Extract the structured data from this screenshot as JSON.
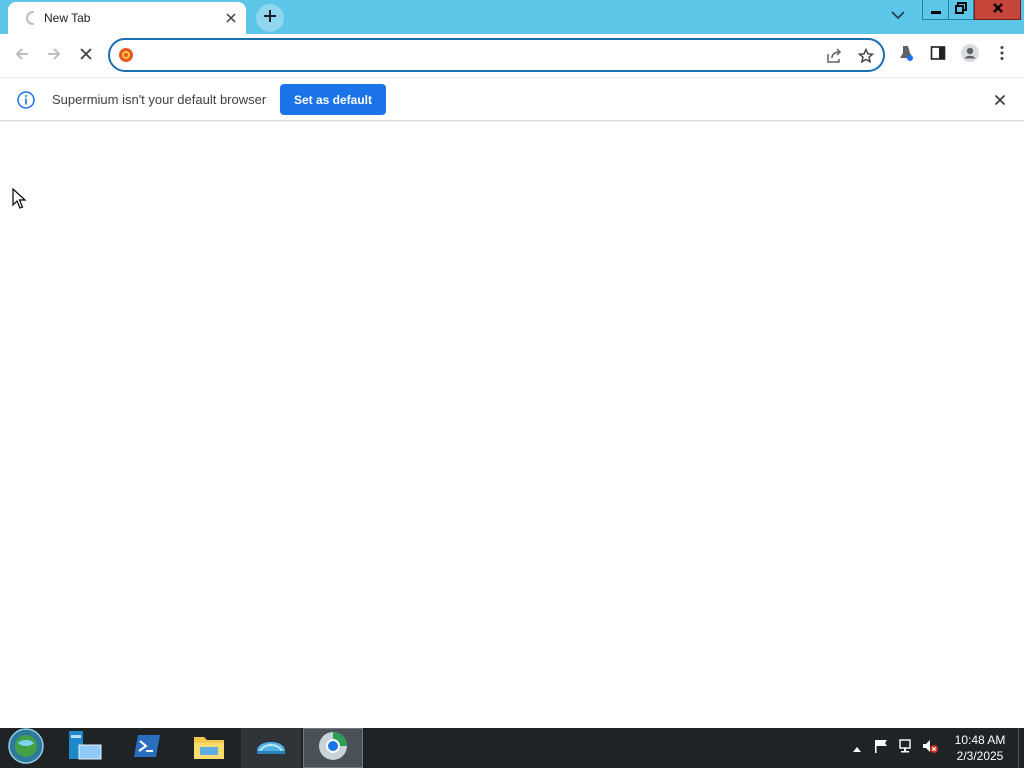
{
  "browser": {
    "tab_title": "New Tab",
    "omnibox_value": "",
    "omnibox_placeholder": ""
  },
  "infobar": {
    "message": "Supermium isn't your default browser",
    "button_label": "Set as default"
  },
  "taskbar": {
    "apps": [
      {
        "name": "server-manager"
      },
      {
        "name": "powershell"
      },
      {
        "name": "file-explorer"
      },
      {
        "name": "network-app"
      },
      {
        "name": "supermium-browser",
        "active": true
      }
    ],
    "time": "10:48 AM",
    "date": "2/3/2025"
  },
  "colors": {
    "tabstrip": "#5cc6e8",
    "accent": "#1a73e8",
    "close_button": "#c7463b",
    "taskbar": "#1f2326"
  },
  "icons": [
    "loading-spinner-icon",
    "close-icon",
    "plus-icon",
    "chevron-down-icon",
    "minimize-icon",
    "restore-icon",
    "back-arrow-icon",
    "forward-arrow-icon",
    "stop-icon",
    "site-info-icon",
    "share-icon",
    "star-icon",
    "extensions-icon",
    "side-panel-icon",
    "profile-icon",
    "kebab-menu-icon",
    "info-icon",
    "flag-icon",
    "network-icon",
    "volume-muted-icon",
    "tray-expand-icon"
  ]
}
